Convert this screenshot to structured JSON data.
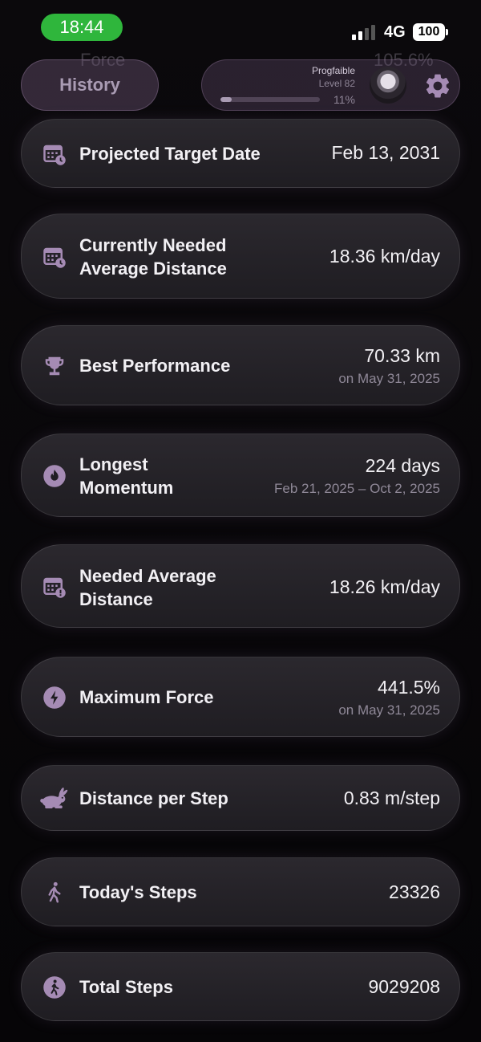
{
  "status_bar": {
    "time": "18:44",
    "network": "4G",
    "battery": "100"
  },
  "background_ghost": {
    "label": "Force",
    "value": "105.6%"
  },
  "header": {
    "history_label": "History",
    "profile": {
      "name": "Progfaible",
      "level": "Level 82",
      "xp_percent": "11%",
      "xp_progress": 0.11
    },
    "icons": {
      "avatar": "user-avatar",
      "settings": "gear-icon"
    }
  },
  "accent_color": "#a58bb4",
  "stats": [
    {
      "label": "Projected Target Date",
      "value": "Feb 13, 2031",
      "icon": "calendar-clock-icon"
    },
    {
      "label": "Currently Needed Average Distance",
      "value": "18.36 km/day",
      "icon": "calendar-clock-icon"
    },
    {
      "label": "Best Performance",
      "value": "70.33 km",
      "sub": "on May 31, 2025",
      "icon": "trophy-icon"
    },
    {
      "label": "Longest Momentum",
      "value": "224 days",
      "sub": "Feb 21, 2025 – Oct 2, 2025",
      "icon": "flame-icon"
    },
    {
      "label": "Needed Average Distance",
      "value": "18.26 km/day",
      "icon": "calendar-alert-icon"
    },
    {
      "label": "Maximum Force",
      "value": "441.5%",
      "sub": "on May 31, 2025",
      "icon": "bolt-icon"
    },
    {
      "label": "Distance per Step",
      "value": "0.83 m/step",
      "icon": "rabbit-icon"
    },
    {
      "label": "Today's Steps",
      "value": "23326",
      "icon": "walking-person-icon"
    },
    {
      "label": "Total Steps",
      "value": "9029208",
      "icon": "walking-circle-icon"
    }
  ]
}
